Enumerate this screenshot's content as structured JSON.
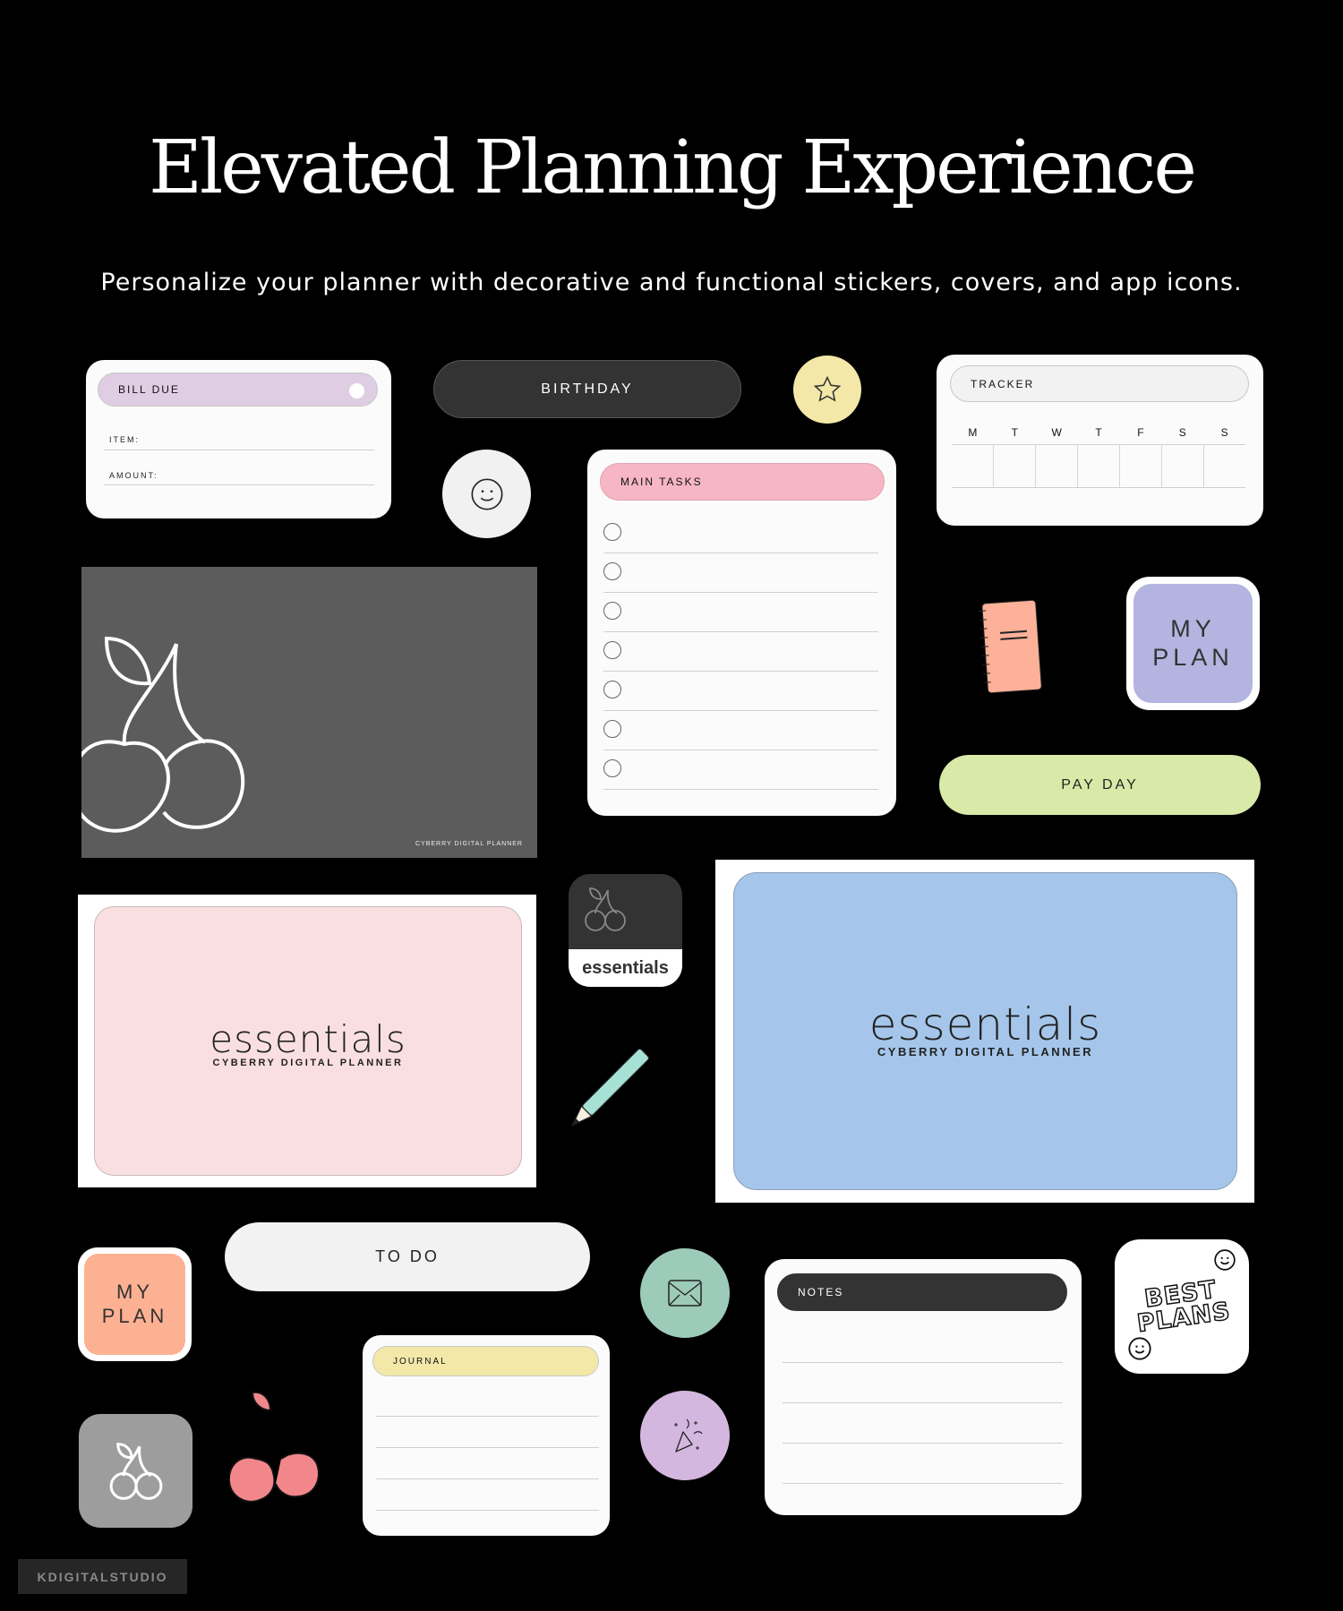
{
  "header": {
    "title": "Elevated Planning Experience",
    "subtitle": "Personalize your planner with decorative and functional stickers, covers, and app icons."
  },
  "bill_due": {
    "title": "BILL DUE",
    "fields": [
      "ITEM:",
      "AMOUNT:"
    ],
    "color": "#dfcde3"
  },
  "birthday": {
    "label": "BIRTHDAY",
    "color": "#333333"
  },
  "star_sticker": {
    "icon": "star-icon",
    "color": "#f3e8a8"
  },
  "smiley_sticker": {
    "icon": "smiley-icon",
    "color": "#f1f1f1"
  },
  "tracker": {
    "title": "TRACKER",
    "days": [
      "M",
      "T",
      "W",
      "T",
      "F",
      "S",
      "S"
    ]
  },
  "main_tasks": {
    "title": "MAIN TASKS",
    "color": "#f6b6c4",
    "task_count": 7
  },
  "cherry_cover": {
    "caption": "CYBERRY DIGITAL PLANNER",
    "color": "#5c5c5c"
  },
  "notebook_sticker": {
    "icon": "notebook-icon",
    "color": "#fcb198"
  },
  "my_plan_purple": {
    "line1": "MY",
    "line2": "PLAN",
    "color": "#b3b4df"
  },
  "pay_day": {
    "label": "PAY DAY",
    "color": "#d8e9a8"
  },
  "pink_cover": {
    "title": "essentials",
    "caption": "CYBERRY DIGITAL PLANNER",
    "color": "#fadfe1"
  },
  "essentials_app": {
    "label": "essentials",
    "icon": "cherry-icon"
  },
  "pencil_sticker": {
    "icon": "pencil-icon",
    "color": "#a7e1d6"
  },
  "blue_cover": {
    "title": "essentials",
    "caption": "CYBERRY DIGITAL PLANNER",
    "color": "#a5c6ea"
  },
  "my_plan_peach": {
    "line1": "MY",
    "line2": "PLAN",
    "color": "#fdb193"
  },
  "to_do": {
    "label": "TO DO",
    "color": "#f2f2f2"
  },
  "mail_sticker": {
    "icon": "mail-icon",
    "color": "#9dcbb9"
  },
  "party_sticker": {
    "icon": "party-popper-icon",
    "color": "#d3b7de"
  },
  "notes": {
    "title": "NOTES",
    "line_count": 4
  },
  "best_plans": {
    "line1": "BEST",
    "line2": "PLANS"
  },
  "journal": {
    "title": "JOURNAL",
    "color": "#f3e8a8",
    "line_count": 4
  },
  "cherry_app": {
    "icon": "cherry-icon",
    "color": "#9d9d9d"
  },
  "pink_cherries": {
    "icon": "cherries-icon",
    "color": "#f2878b"
  },
  "watermark": {
    "label": "KDIGITALSTUDIO"
  }
}
